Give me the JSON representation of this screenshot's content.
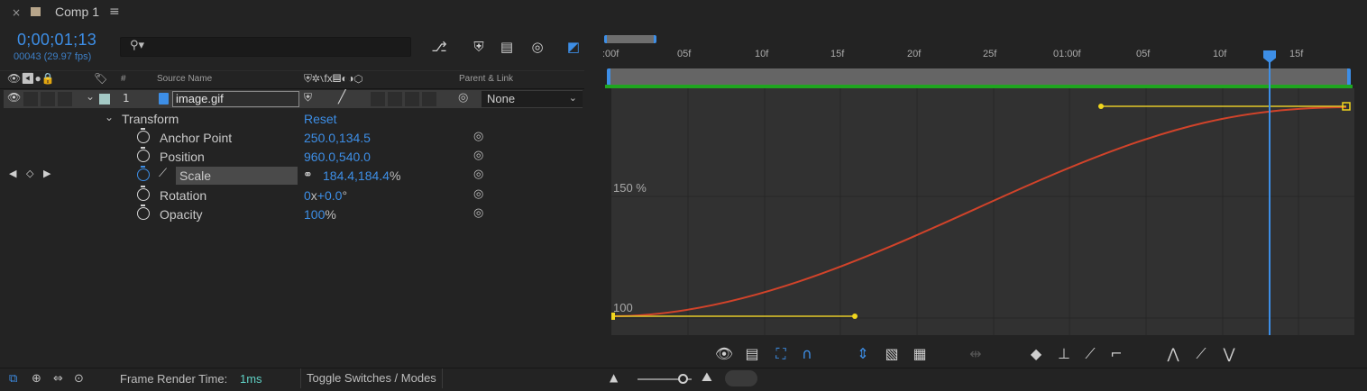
{
  "tab": {
    "close": "×",
    "title": "Comp 1",
    "menu": "≡"
  },
  "timeline": {
    "timecode": "0;00;01;13",
    "frames": "00043 (29.97 fps)",
    "search_placeholder": ""
  },
  "columns": {
    "num": "#",
    "source": "Source Name",
    "parent": "Parent & Link"
  },
  "layer": {
    "num": "1",
    "name": "image.gif",
    "parent": "None"
  },
  "transform": {
    "label": "Transform",
    "reset": "Reset",
    "properties": [
      {
        "label": "Anchor Point",
        "value": "250.0,134.5",
        "unit": ""
      },
      {
        "label": "Position",
        "value": "960.0,540.0",
        "unit": ""
      },
      {
        "label": "Scale",
        "value": "184.4,184.4",
        "unit": "%"
      },
      {
        "label": "Rotation",
        "value": "0",
        "unit": "x",
        "value2": "+0.0",
        "unit2": "°"
      },
      {
        "label": "Opacity",
        "value": "100",
        "unit": "%"
      }
    ]
  },
  "ruler": {
    "ticks": [
      ":00f",
      "05f",
      "10f",
      "15f",
      "20f",
      "25f",
      "01:00f",
      "05f",
      "10f",
      "15f"
    ]
  },
  "graph": {
    "label_150": "150 %",
    "label_100": "100"
  },
  "status": {
    "frame_render_label": "Frame Render Time:",
    "frame_render_value": "1ms",
    "toggle": "Toggle Switches / Modes"
  }
}
